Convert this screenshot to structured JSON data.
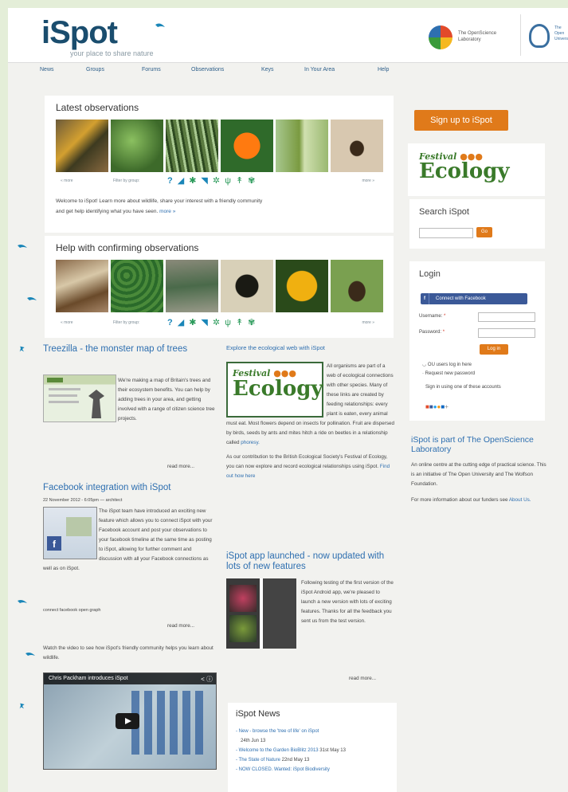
{
  "header": {
    "logo": "iSpot",
    "tagline": "your place to share nature",
    "partner_logo_text": "The OpenScience Laboratory",
    "ou_logo_text": "The Open University"
  },
  "nav": [
    "News",
    "Groups",
    "Forums",
    "Observations",
    "Keys",
    "In Your Area",
    "Help"
  ],
  "latest": {
    "title": "Latest observations",
    "more_left": "« more",
    "filter_label": "Filter by group:",
    "more_right": "more »",
    "welcome": "Welcome to iSpot! Learn more about wildlife, share your interest with a friendly community",
    "welcome2": "and get help identifying what you have seen.",
    "welcome_more": "more »"
  },
  "help": {
    "title": "Help with confirming observations",
    "more_left": "« more",
    "filter_label": "Filter by group:",
    "more_right": "more »"
  },
  "treezilla": {
    "title": "Treezilla - the monster map of trees",
    "body": "We're making a map of Britain's trees and their ecosystem benefits. You can help by adding trees in your area, and getting involved with a range of citizen science tree projects.",
    "read_more": "read more..."
  },
  "facebook": {
    "title": "Facebook integration with iSpot",
    "meta": "22 November 2012 - 6:05pm — architect",
    "body": "The iSpot team have introduced an exciting new feature which allows you to connect iSpot with your Facebook account and post your observations to your facebook timeline at the same time as posting to iSpot, allowing for further comment and discussion with all your Facebook connections as well as on iSpot.",
    "tags": "connect   facebook   open graph",
    "read_more": "read more..."
  },
  "video_intro": "Watch the video to see how iSpot's friendly community helps you learn about wildlife.",
  "video_title": "Chris Packham introduces iSpot",
  "ecology": {
    "title": "Explore the ecological web with iSpot",
    "festival_logo": "Festival of Ecology",
    "body1": "All organisms are part of a web of ecological connections with other species.",
    "body2": "Many of these links are created by feeding relationships: every plant is eaten, every animal must eat. Most flowers depend on insects for pollination. Fruit are dispersed by birds, seeds by ants and mites hitch a ride on beetles in a relationship called",
    "phoresy": "phoresy.",
    "body3": "As our contribution to the British Ecological Society's Festival of Ecology, you can now explore and record ecological relationships using iSpot.",
    "find_out": "Find out how here"
  },
  "app": {
    "title": "iSpot app launched - now updated with lots of new features",
    "body": "Following testing of the first version of the iSpot Android app, we're pleased to launch a new version with lots of exciting features. Thanks for all the feedback you sent us from the test version.",
    "read_more": "read more..."
  },
  "news": {
    "title": "iSpot News",
    "items": [
      {
        "text": "New - browse the 'tree of life' on iSpot",
        "date": "24th Jun 13"
      },
      {
        "text": "Welcome to the Garden BioBlitz 2013",
        "date": "31st May 13"
      },
      {
        "text": "The State of Nature",
        "date": "22nd May 13"
      },
      {
        "text": "NOW CLOSED. Wanted: iSpot Biodiversity",
        "date": ""
      }
    ]
  },
  "sidebar": {
    "signup": "Sign up to iSpot",
    "festival": "Festival of Ecology",
    "search_title": "Search iSpot",
    "go": "Go",
    "login_title": "Login",
    "fb_connect": "Connect with Facebook",
    "username_label": "Username:",
    "password_label": "Password:",
    "login_btn": "Log in",
    "ou_users": "OU users log in here",
    "request_pw": "Request new password",
    "signin_other": "Sign in using one of these accounts",
    "part_title": "iSpot is part of The OpenScience Laboratory",
    "part_body": "An online centre at the cutting edge of practical science. This is an initiative of The Open University and The Wolfson Foundation.",
    "funders": "For more information about our funders see",
    "about_us": "About Us."
  },
  "colors": {
    "accent": "#e07a1a",
    "link": "#2e6fb0",
    "logo": "#1a4d6e",
    "facebook": "#3b5998",
    "border": "#e4eed8"
  },
  "icons": [
    "question-icon",
    "bird-icon",
    "bug-icon",
    "fish-icon",
    "frog-icon",
    "plant-icon",
    "tree-icon",
    "fungi-icon"
  ]
}
